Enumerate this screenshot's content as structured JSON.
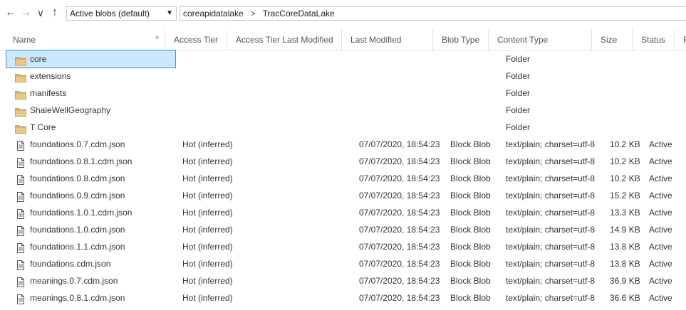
{
  "toolbar": {
    "back_icon": "←",
    "forward_icon": "→",
    "history_icon": "∨",
    "up_icon": "↑",
    "blob_filter": "Active blobs (default)",
    "path": [
      "coreapidatalake",
      "TracCoreDataLake"
    ],
    "path_separator": ">"
  },
  "columns": {
    "name": "Name",
    "access_tier": "Access Tier",
    "access_tier_modified": "Access Tier Last Modified",
    "last_modified": "Last Modified",
    "blob_type": "Blob Type",
    "content_type": "Content Type",
    "size": "Size",
    "status": "Status",
    "extra": "F"
  },
  "rows": [
    {
      "name": "core",
      "type": "folder",
      "tier": "",
      "modified": "",
      "blob_type": "",
      "content_type": "Folder",
      "size": "",
      "status": ""
    },
    {
      "name": "extensions",
      "type": "folder",
      "tier": "",
      "modified": "",
      "blob_type": "",
      "content_type": "Folder",
      "size": "",
      "status": ""
    },
    {
      "name": "manifests",
      "type": "folder",
      "tier": "",
      "modified": "",
      "blob_type": "",
      "content_type": "Folder",
      "size": "",
      "status": ""
    },
    {
      "name": "ShaleWellGeography",
      "type": "folder",
      "tier": "",
      "modified": "",
      "blob_type": "",
      "content_type": "Folder",
      "size": "",
      "status": ""
    },
    {
      "name": "T      Core",
      "type": "folder",
      "tier": "",
      "modified": "",
      "blob_type": "",
      "content_type": "Folder",
      "size": "",
      "status": ""
    },
    {
      "name": "foundations.0.7.cdm.json",
      "type": "file",
      "tier": "Hot (inferred)",
      "modified": "07/07/2020, 18:54:23",
      "blob_type": "Block Blob",
      "content_type": "text/plain; charset=utf-8",
      "size": "10.2 KB",
      "status": "Active"
    },
    {
      "name": "foundations.0.8.1.cdm.json",
      "type": "file",
      "tier": "Hot (inferred)",
      "modified": "07/07/2020, 18:54:23",
      "blob_type": "Block Blob",
      "content_type": "text/plain; charset=utf-8",
      "size": "10.2 KB",
      "status": "Active"
    },
    {
      "name": "foundations.0.8.cdm.json",
      "type": "file",
      "tier": "Hot (inferred)",
      "modified": "07/07/2020, 18:54:23",
      "blob_type": "Block Blob",
      "content_type": "text/plain; charset=utf-8",
      "size": "10.2 KB",
      "status": "Active"
    },
    {
      "name": "foundations.0.9.cdm.json",
      "type": "file",
      "tier": "Hot (inferred)",
      "modified": "07/07/2020, 18:54:23",
      "blob_type": "Block Blob",
      "content_type": "text/plain; charset=utf-8",
      "size": "15.2 KB",
      "status": "Active"
    },
    {
      "name": "foundations.1.0.1.cdm.json",
      "type": "file",
      "tier": "Hot (inferred)",
      "modified": "07/07/2020, 18:54:23",
      "blob_type": "Block Blob",
      "content_type": "text/plain; charset=utf-8",
      "size": "13.3 KB",
      "status": "Active"
    },
    {
      "name": "foundations.1.0.cdm.json",
      "type": "file",
      "tier": "Hot (inferred)",
      "modified": "07/07/2020, 18:54:23",
      "blob_type": "Block Blob",
      "content_type": "text/plain; charset=utf-8",
      "size": "14.9 KB",
      "status": "Active"
    },
    {
      "name": "foundations.1.1.cdm.json",
      "type": "file",
      "tier": "Hot (inferred)",
      "modified": "07/07/2020, 18:54:23",
      "blob_type": "Block Blob",
      "content_type": "text/plain; charset=utf-8",
      "size": "13.8 KB",
      "status": "Active"
    },
    {
      "name": "foundations.cdm.json",
      "type": "file",
      "tier": "Hot (inferred)",
      "modified": "07/07/2020, 18:54:23",
      "blob_type": "Block Blob",
      "content_type": "text/plain; charset=utf-8",
      "size": "13.8 KB",
      "status": "Active"
    },
    {
      "name": "meanings.0.7.cdm.json",
      "type": "file",
      "tier": "Hot (inferred)",
      "modified": "07/07/2020, 18:54:23",
      "blob_type": "Block Blob",
      "content_type": "text/plain; charset=utf-8",
      "size": "36.9 KB",
      "status": "Active"
    },
    {
      "name": "meanings.0.8.1.cdm.json",
      "type": "file",
      "tier": "Hot (inferred)",
      "modified": "07/07/2020, 18:54:23",
      "blob_type": "Block Blob",
      "content_type": "text/plain; charset=utf-8",
      "size": "36.6 KB",
      "status": "Active"
    }
  ],
  "colors": {
    "selection_bg": "#cce8ff",
    "selection_border": "#3f95d6",
    "folder": "#dcb67a"
  }
}
